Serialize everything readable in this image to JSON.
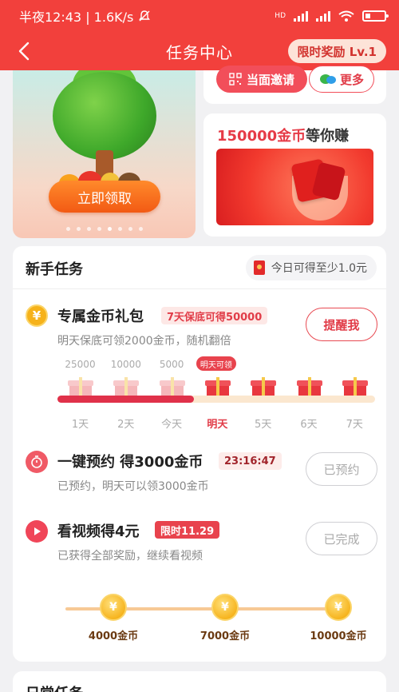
{
  "status_bar": {
    "time": "半夜12:43 | 1.6K/s",
    "network": "HD"
  },
  "header": {
    "title": "任务中心",
    "reward_badge": "限时奖励 Lv.1"
  },
  "banner": {
    "claim_label": "立即领取",
    "carousel": {
      "total": 8,
      "active_index": 4
    }
  },
  "invite": {
    "face_invite_label": "当面邀请",
    "more_label": "更多"
  },
  "coins_promo": {
    "highlight": "150000金币",
    "suffix": "等你赚"
  },
  "newbie": {
    "title": "新手任务",
    "hint": "今日可得至少1.0元",
    "tasks": [
      {
        "name": "专属金币礼包",
        "tag": "7天保底可得50000",
        "desc": "明天保底可领2000金币，随机翻倍",
        "button": "提醒我",
        "icon": "coin-icon"
      },
      {
        "name": "一键预约 得3000金币",
        "tag": "23:16:47",
        "desc": "已预约，明天可以领3000金币",
        "button": "已预约",
        "icon": "stopwatch-icon"
      },
      {
        "name": "看视频得4元",
        "tag": "限时11.29",
        "desc": "已获得全部奖励，继续看视频",
        "button": "已完成",
        "icon": "play-icon"
      }
    ],
    "gift_days": [
      {
        "amount": "25000",
        "day": "1天",
        "state": "past"
      },
      {
        "amount": "10000",
        "day": "2天",
        "state": "past"
      },
      {
        "amount": "5000",
        "day": "今天",
        "state": "past"
      },
      {
        "amount": "明天可领",
        "day": "明天",
        "state": "current"
      },
      {
        "amount": "",
        "day": "5天",
        "state": "future"
      },
      {
        "amount": "",
        "day": "6天",
        "state": "future"
      },
      {
        "amount": "",
        "day": "7天",
        "state": "future"
      }
    ],
    "gift_progress": 0.43,
    "milestones": [
      {
        "coin": "¥",
        "label": "4000金币"
      },
      {
        "coin": "¥",
        "label": "7000金币"
      },
      {
        "coin": "¥",
        "label": "10000金币"
      }
    ]
  },
  "daily": {
    "title": "日常任务"
  },
  "colors": {
    "brand_red": "#f2403c",
    "accent": "#e13c48",
    "progress": "#e0314a",
    "coin_gold": "#f6b21a"
  }
}
